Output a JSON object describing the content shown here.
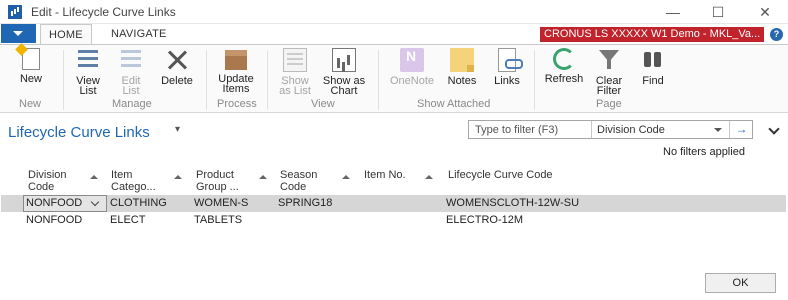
{
  "window": {
    "title": "Edit - Lifecycle Curve Links",
    "controls": {
      "minimize": "—",
      "maximize": "☐",
      "close": "✕"
    }
  },
  "ribbon_tabs": [
    {
      "label": "HOME",
      "active": true
    },
    {
      "label": "NAVIGATE",
      "active": false
    }
  ],
  "company": "CRONUS LS XXXXX W1 Demo - MKL_Va...",
  "help": "?",
  "ribbon": {
    "groups": [
      {
        "label": "New"
      },
      {
        "label": "Manage"
      },
      {
        "label": "Process"
      },
      {
        "label": "View"
      },
      {
        "label": "Show Attached"
      },
      {
        "label": "Page"
      }
    ],
    "buttons": {
      "new": "New",
      "view_list": "View\nList",
      "edit_list": "Edit\nList",
      "delete": "Delete",
      "update_items": "Update\nItems",
      "show_as_list": "Show\nas List",
      "show_as_chart": "Show as\nChart",
      "onenote": "OneNote",
      "notes": "Notes",
      "links": "Links",
      "refresh": "Refresh",
      "clear_filter": "Clear\nFilter",
      "find": "Find"
    },
    "icons": {
      "new": "new-document-icon",
      "view_list": "view-list-icon",
      "edit_list": "edit-list-icon",
      "delete": "delete-icon",
      "update_items": "update-items-icon",
      "show_as_list": "show-as-list-icon",
      "show_as_chart": "show-as-chart-icon",
      "onenote": "onenote-icon",
      "notes": "notes-icon",
      "links": "links-icon",
      "refresh": "refresh-icon",
      "clear_filter": "clear-filter-icon",
      "find": "find-icon"
    }
  },
  "page": {
    "title": "Lifecycle Curve Links",
    "title_menu": "▾",
    "filter": {
      "placeholder": "Type to filter (F3)",
      "field": "Division Code",
      "go": "→"
    },
    "no_filters": "No filters applied"
  },
  "table": {
    "columns": [
      {
        "line1": "Division",
        "line2": "Code"
      },
      {
        "line1": "Item",
        "line2": "Catego..."
      },
      {
        "line1": "Product",
        "line2": "Group ..."
      },
      {
        "line1": "Season",
        "line2": "Code"
      },
      {
        "line1": "Item No.",
        "line2": ""
      },
      {
        "line1": "Lifecycle Curve Code",
        "line2": ""
      }
    ],
    "rows": [
      {
        "division": "NONFOOD",
        "item_category": "CLOTHING",
        "product_group": "WOMEN-S",
        "season": "SPRING18",
        "item_no": "",
        "curve": "WOMENSCLOTH-12W-SU",
        "selected": true
      },
      {
        "division": "NONFOOD",
        "item_category": "ELECT",
        "product_group": "TABLETS",
        "season": "",
        "item_no": "",
        "curve": "ELECTRO-12M",
        "selected": false
      }
    ]
  },
  "footer": {
    "ok": "OK"
  },
  "colors": {
    "accent": "#1f67b5",
    "company_banner": "#c0232b",
    "selected_row": "#d6d6d6"
  }
}
